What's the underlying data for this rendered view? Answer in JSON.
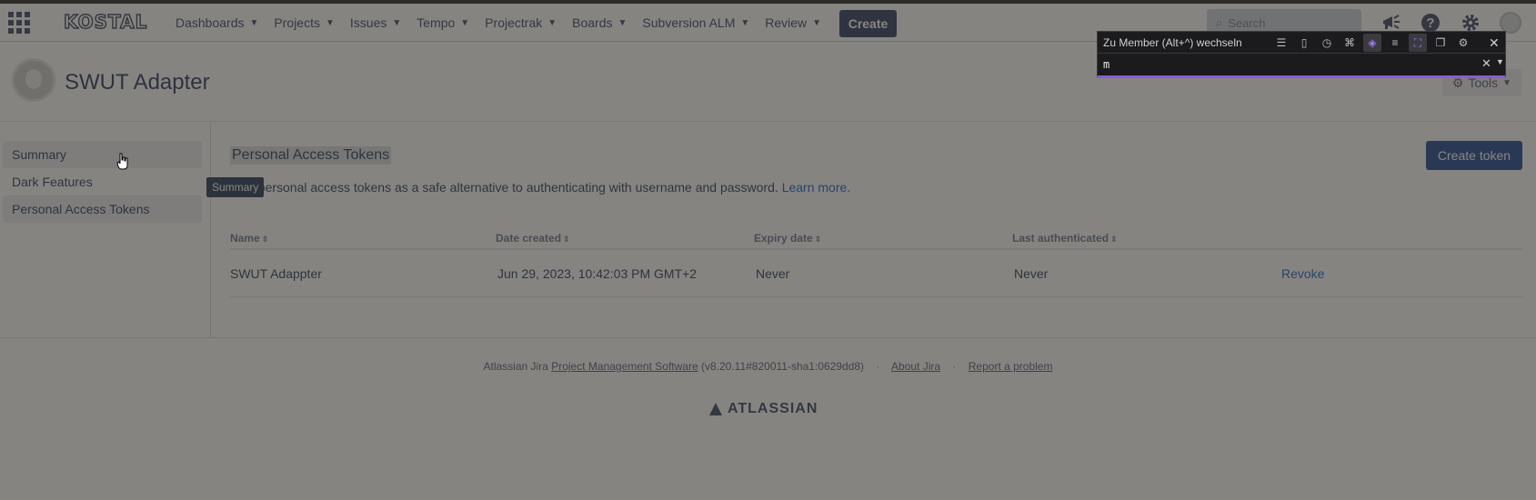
{
  "navbar": {
    "logo": "KOSTAL",
    "menu": [
      {
        "label": "Dashboards"
      },
      {
        "label": "Projects"
      },
      {
        "label": "Issues"
      },
      {
        "label": "Tempo"
      },
      {
        "label": "Projectrak"
      },
      {
        "label": "Boards"
      },
      {
        "label": "Subversion ALM"
      },
      {
        "label": "Review"
      }
    ],
    "create_label": "Create",
    "search_placeholder": "Search",
    "icons": [
      "megaphone-icon",
      "help-icon",
      "gear-icon",
      "avatar"
    ]
  },
  "project": {
    "title": "SWUT Adapter",
    "tools_label": "Tools"
  },
  "sidebar": {
    "items": [
      {
        "label": "Summary"
      },
      {
        "label": "Dark Features"
      },
      {
        "label": "Personal Access Tokens"
      }
    ],
    "tooltip": "Summary"
  },
  "main": {
    "section_title": "Personal Access Tokens",
    "create_token_label": "Create token",
    "description_prefix": "Use personal access tokens as a safe alternative to authenticating with username and password.",
    "learn_more": "Learn more.",
    "table": {
      "headers": [
        "Name",
        "Date created",
        "Expiry date",
        "Last authenticated"
      ],
      "rows": [
        {
          "name": "SWUT Adappter",
          "date_created": "Jun 29, 2023, 10:42:03 PM GMT+2",
          "expiry_date": "Never",
          "last_authenticated": "Never",
          "action": "Revoke"
        }
      ]
    }
  },
  "footer": {
    "prefix": "Atlassian Jira",
    "pms_link": "Project Management Software",
    "version": "(v8.20.11#820011-sha1:0629dd8)",
    "about": "About Jira",
    "report": "Report a problem",
    "brand": "ATLASSIAN"
  },
  "extension": {
    "title": "Zu Member (Alt+^) wechseln",
    "input_value": "m",
    "accent_color": "#8a5bd6"
  }
}
